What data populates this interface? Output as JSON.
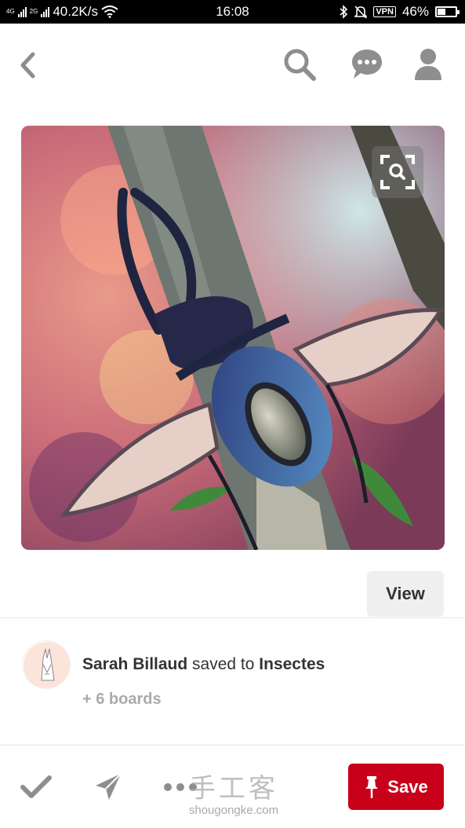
{
  "status_bar": {
    "network_1": "4G",
    "network_2": "2G",
    "speed": "40.2K/s",
    "time": "16:08",
    "vpn": "VPN",
    "battery": "46%",
    "battery_level": 0.46
  },
  "topbar": {
    "back_icon": "chevron-left-icon",
    "search_icon": "search-icon",
    "chat_icon": "speech-bubble-icon",
    "profile_icon": "person-icon"
  },
  "pin": {
    "image_alt": "",
    "zoom_icon": "visual-search-icon",
    "view_label": "View"
  },
  "save_info": {
    "user_name": "Sarah Billaud",
    "saved_to_text": "saved to",
    "board_name": "Insectes",
    "more_boards": "+ 6 boards"
  },
  "bottom_bar": {
    "done_icon": "check-icon",
    "send_icon": "send-icon",
    "more_icon": "more-dots-icon",
    "save_label": "Save",
    "save_icon": "pin-icon",
    "watermark_cn": "手工客",
    "watermark_url": "shougongke.com"
  },
  "colors": {
    "save_red": "#c8001a",
    "icon_gray": "#8e8e8e"
  }
}
